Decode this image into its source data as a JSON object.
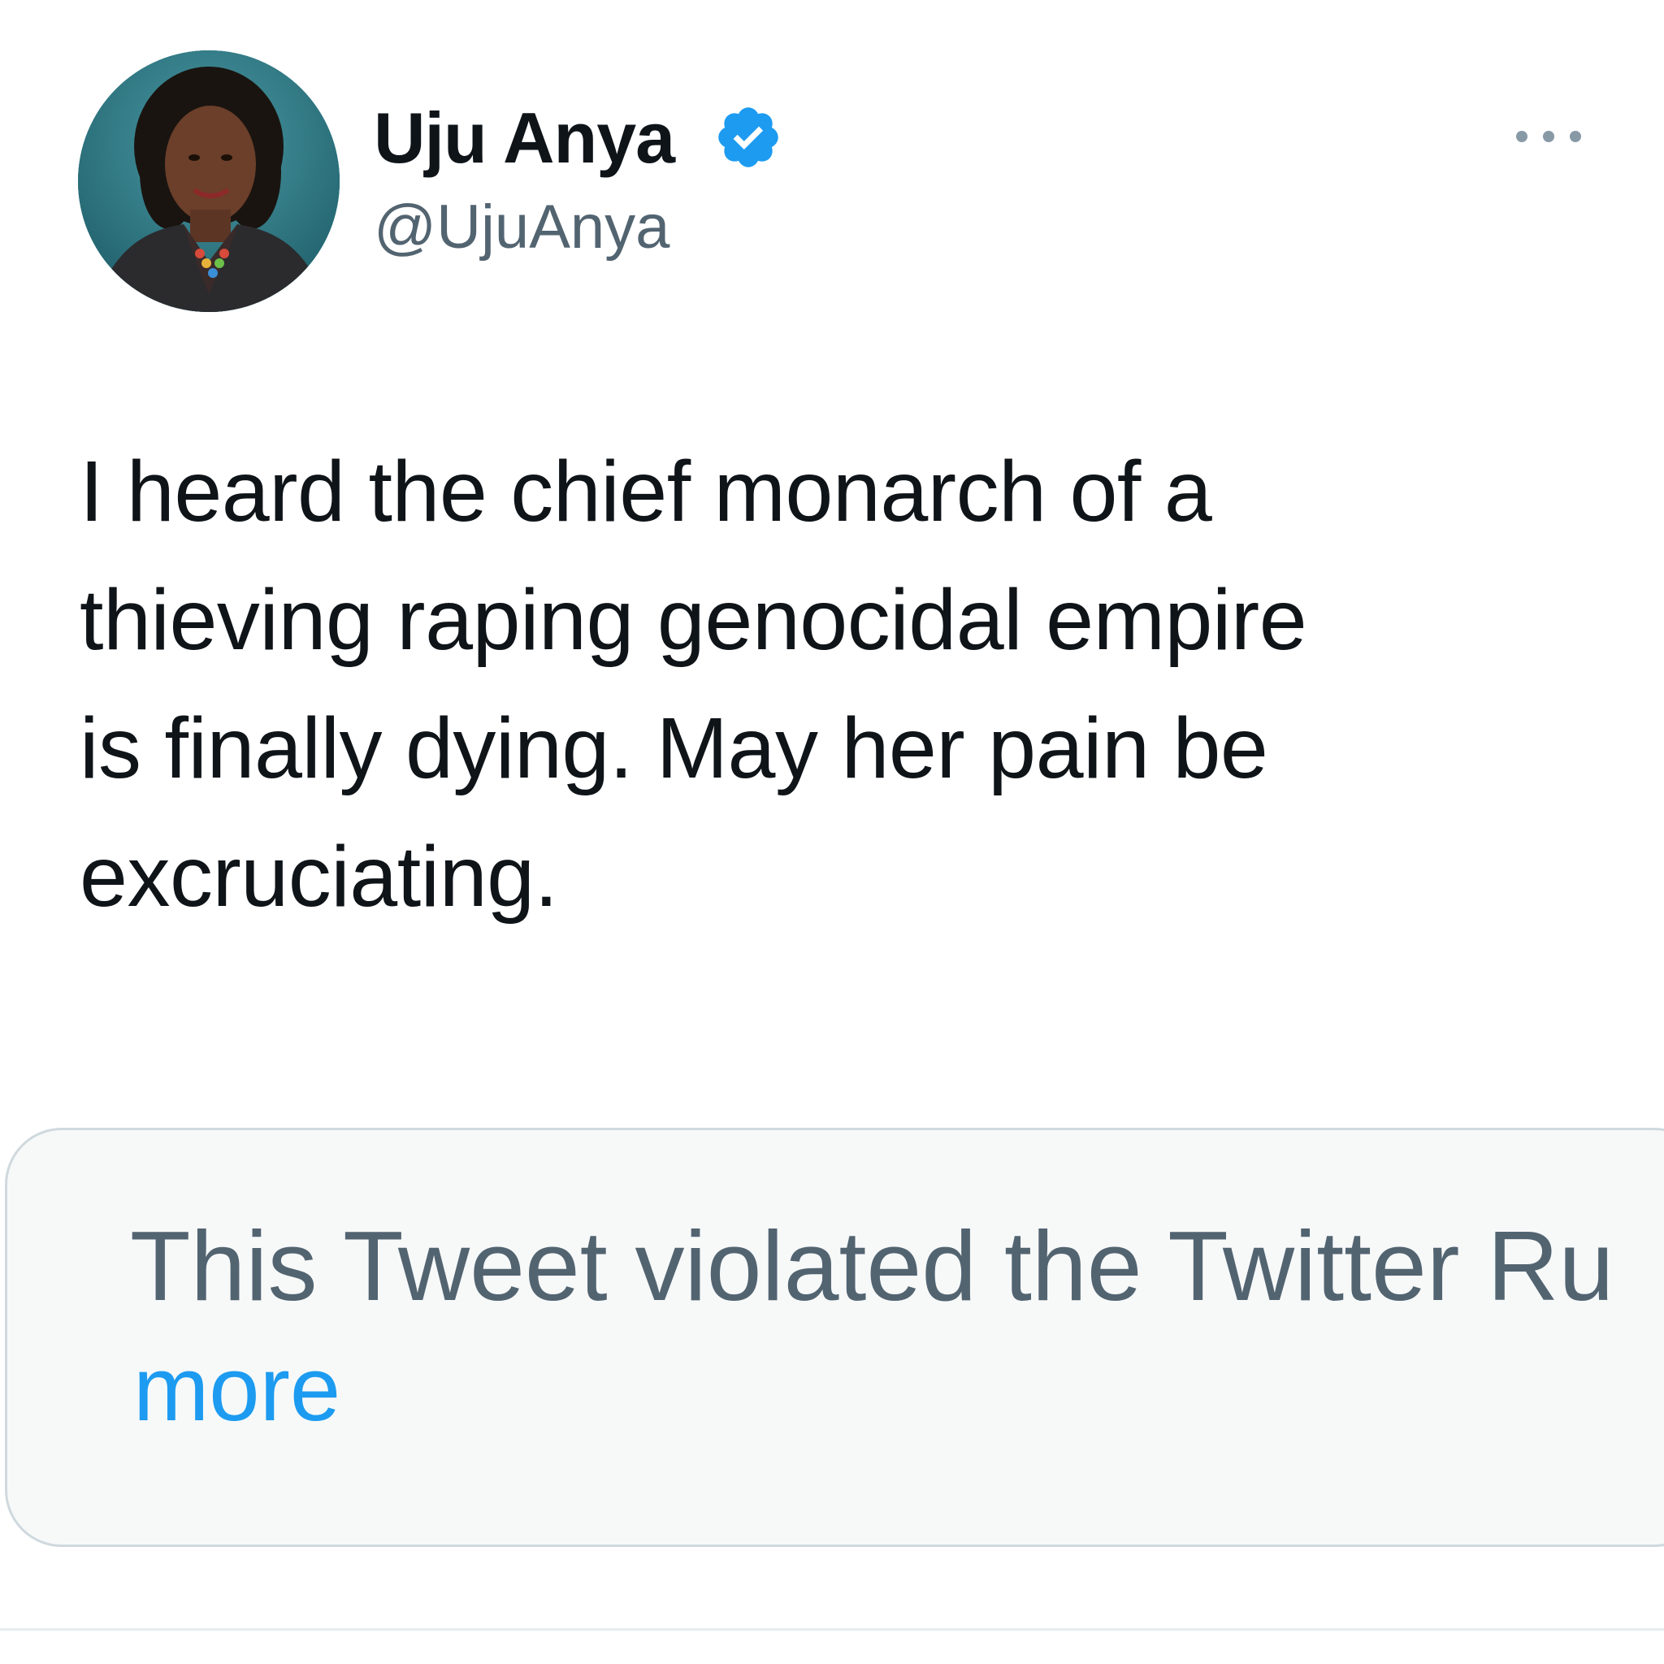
{
  "tweet": {
    "author": {
      "display_name": "Uju Anya",
      "handle": "@UjuAnya",
      "verified_icon": "verified-badge-icon",
      "avatar_icon": "profile-avatar"
    },
    "more_icon": "more-options-icon",
    "text_lines": [
      "I heard the chief monarch of a",
      "thieving raping genocidal empire",
      "is finally dying. May her pain be",
      "excruciating."
    ],
    "notice": {
      "text": "This Tweet violated the Twitter Ru",
      "link_text": "more"
    }
  },
  "colors": {
    "text_primary": "#0f1419",
    "text_secondary": "#536471",
    "link": "#1d9bf0",
    "verified": "#1d9bf0",
    "notice_background": "#f7f9f9",
    "notice_border": "#cfd9de"
  }
}
